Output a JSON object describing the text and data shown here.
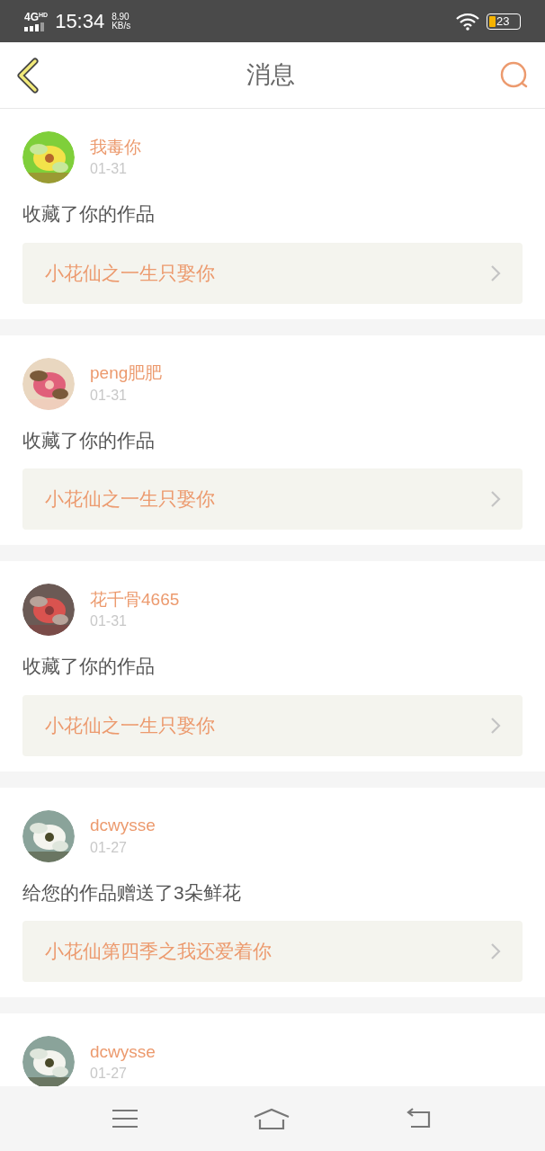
{
  "status_bar": {
    "network": "4G",
    "network_badge": "HD",
    "time": "15:34",
    "speed": "8.90",
    "speed_unit": "KB/s",
    "battery": "23"
  },
  "header": {
    "title": "消息"
  },
  "messages": [
    {
      "user": "我毒你",
      "date": "01-31",
      "action": "收藏了你的作品",
      "work": "小花仙之一生只娶你"
    },
    {
      "user": "peng肥肥",
      "date": "01-31",
      "action": "收藏了你的作品",
      "work": "小花仙之一生只娶你"
    },
    {
      "user": "花千骨4665",
      "date": "01-31",
      "action": "收藏了你的作品",
      "work": "小花仙之一生只娶你"
    },
    {
      "user": "dcwysse",
      "date": "01-27",
      "action": "给您的作品赠送了3朵鲜花",
      "work": "小花仙第四季之我还爱着你"
    },
    {
      "user": "dcwysse",
      "date": "01-27"
    }
  ]
}
